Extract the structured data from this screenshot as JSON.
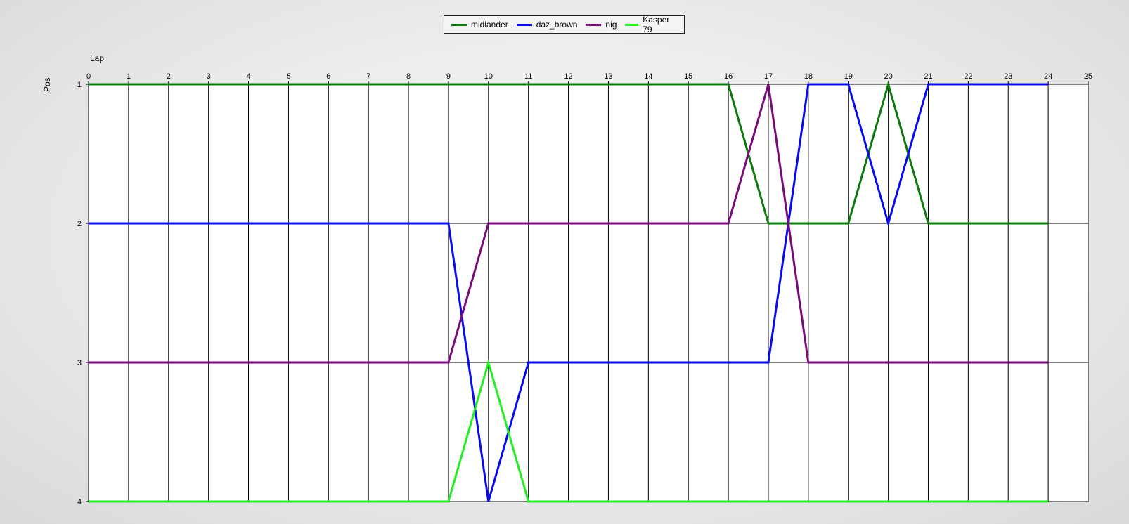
{
  "chart_data": {
    "type": "line",
    "xlabel": "Lap",
    "ylabel": "Pos",
    "xlim": [
      0,
      25
    ],
    "ylim": [
      1,
      4
    ],
    "y_inverted": true,
    "x_ticks": [
      0,
      1,
      2,
      3,
      4,
      5,
      6,
      7,
      8,
      9,
      10,
      11,
      12,
      13,
      14,
      15,
      16,
      17,
      18,
      19,
      20,
      21,
      22,
      23,
      24,
      25
    ],
    "y_ticks": [
      1,
      2,
      3,
      4
    ],
    "grid": true,
    "legend_placement": "top-center",
    "x": [
      0,
      1,
      2,
      3,
      4,
      5,
      6,
      7,
      8,
      9,
      10,
      11,
      12,
      13,
      14,
      15,
      16,
      17,
      18,
      19,
      20,
      21,
      22,
      23,
      24
    ],
    "series": [
      {
        "name": "midlander",
        "color": "#0a7a0a",
        "values": [
          1,
          1,
          1,
          1,
          1,
          1,
          1,
          1,
          1,
          1,
          1,
          1,
          1,
          1,
          1,
          1,
          1,
          2,
          2,
          2,
          1,
          2,
          2,
          2,
          2
        ]
      },
      {
        "name": "daz_brown",
        "color": "#0a0af0",
        "values": [
          2,
          2,
          2,
          2,
          2,
          2,
          2,
          2,
          2,
          2,
          4,
          3,
          3,
          3,
          3,
          3,
          3,
          3,
          1,
          1,
          2,
          1,
          1,
          1,
          1
        ]
      },
      {
        "name": "nig",
        "color": "#7a0a7a",
        "values": [
          3,
          3,
          3,
          3,
          3,
          3,
          3,
          3,
          3,
          3,
          2,
          2,
          2,
          2,
          2,
          2,
          2,
          1,
          3,
          3,
          3,
          3,
          3,
          3,
          3
        ]
      },
      {
        "name": "Kasper 79",
        "color": "#22ee22",
        "values": [
          4,
          4,
          4,
          4,
          4,
          4,
          4,
          4,
          4,
          4,
          3,
          4,
          4,
          4,
          4,
          4,
          4,
          4,
          4,
          4,
          4,
          4,
          4,
          4,
          4
        ]
      }
    ]
  }
}
